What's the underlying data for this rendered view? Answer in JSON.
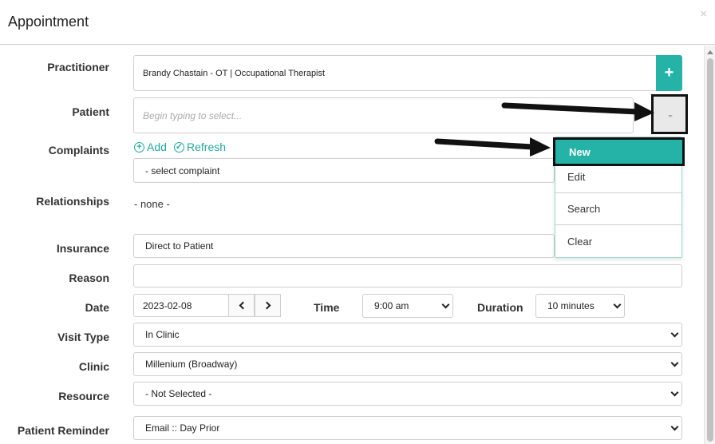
{
  "dialog": {
    "title": "Appointment",
    "close_label": "×"
  },
  "labels": {
    "practitioner": "Practitioner",
    "patient": "Patient",
    "complaints": "Complaints",
    "relationships": "Relationships",
    "insurance": "Insurance",
    "reason": "Reason",
    "date": "Date",
    "time": "Time",
    "duration": "Duration",
    "visit_type": "Visit Type",
    "clinic": "Clinic",
    "resource": "Resource",
    "patient_reminder": "Patient Reminder"
  },
  "fields": {
    "practitioner_value": "Brandy Chastain - OT | Occupational Therapist",
    "practitioner_add_label": "+",
    "patient_placeholder": "Begin typing to select...",
    "complaint_add": "Add",
    "complaint_refresh": "Refresh",
    "complaint_select": "- select complaint",
    "relationships_value": "- none -",
    "insurance_value": "Direct to Patient",
    "reason_value": "",
    "date_value": "2023-02-08",
    "time_value": "9:00 am",
    "duration_value": "10 minutes",
    "visit_type_value": "In Clinic",
    "clinic_value": "Millenium (Broadway)",
    "resource_value": "- Not Selected -",
    "patient_reminder_value": "Email :: Day Prior"
  },
  "patient_menu": {
    "items": [
      "New",
      "Edit",
      "Search",
      "Clear"
    ]
  },
  "colors": {
    "accent": "#26b3a7",
    "link": "#21a99d",
    "annotation": "#111111"
  },
  "icons": {
    "complaint_add": "plus-circle-icon",
    "complaint_refresh": "check-circle-icon",
    "date_prev": "chevron-left-icon",
    "date_next": "chevron-right-icon"
  }
}
